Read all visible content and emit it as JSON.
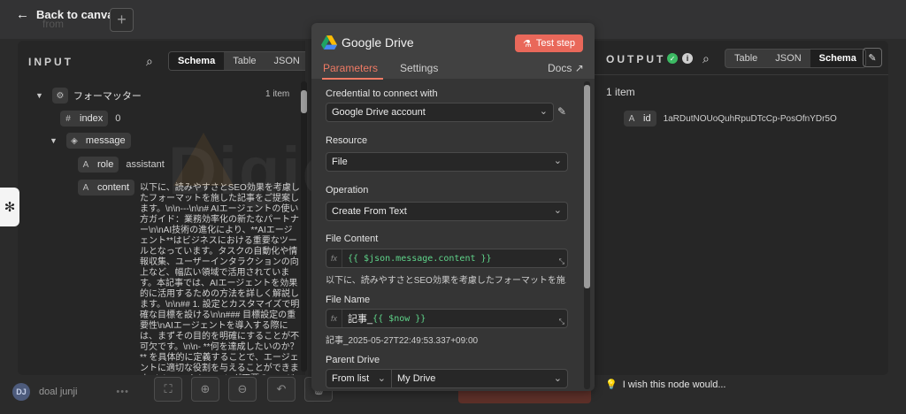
{
  "topbar": {
    "back_label": "Back to canvas",
    "back_icon": "arrow-left-icon",
    "ghost_label": "from",
    "plus_label": "+"
  },
  "input": {
    "title": "INPUT",
    "tabs": [
      "Schema",
      "Table",
      "JSON"
    ],
    "active_tab": "Schema",
    "node_name": "フォーマッター",
    "item_count": "1 item",
    "fields": [
      {
        "key": "index",
        "type_icon": "#",
        "value": "0"
      },
      {
        "key": "message",
        "type_icon": "cube"
      },
      {
        "key": "role",
        "type_icon": "A",
        "value": "assistant"
      },
      {
        "key": "content",
        "type_icon": "A"
      }
    ],
    "content_value": "以下に、読みやすさとSEO効果を考慮したフォーマットを施した記事をご提案します。\\n\\n---\\n\\n# AIエージェントの使い方ガイド：業務効率化の新たなパートナー\\n\\nAI技術の進化により、**AIエージェント**はビジネスにおける重要なツールとなっています。タスクの自動化や情報収集、ユーザーインタラクションの向上など、幅広い領域で活用されています。本記事では、AIエージェントを効果的に活用するための方法を詳しく解説します。\\n\\n## 1. 設定とカスタマイズで明確な目標を設ける\\n\\n### 目標設定の重要性\\nAIエージェントを導入する際には、まずその目的を明確にすることが不可欠です。\\n\\n- **何を達成したいのか？** を具体的に定義することで、エージェントに適切な役割を与えることができます。\\n\\n### トレーニング不要のエージェント\\n\\n最近のAIプラットフォームでは、専門的なプログラミング知識がなくても構築"
  },
  "node": {
    "title": "Google Drive",
    "test_label": "Test step",
    "tabs": {
      "parameters": "Parameters",
      "settings": "Settings",
      "docs": "Docs"
    },
    "credential": {
      "label": "Credential to connect with",
      "value": "Google Drive account"
    },
    "resource": {
      "label": "Resource",
      "value": "File"
    },
    "operation": {
      "label": "Operation",
      "value": "Create From Text"
    },
    "file_content": {
      "label": "File Content",
      "expression": "{{ $json.message.content }}",
      "preview": "以下に、読みやすさとSEO効果を考慮したフォーマットを施..."
    },
    "file_name": {
      "label": "File Name",
      "prefix": "記事_",
      "expression": "{{ $now }}",
      "preview": "記事_2025-05-27T22:49:53.337+09:00"
    },
    "parent_drive": {
      "label": "Parent Drive",
      "mode": "From list",
      "value": "My Drive"
    }
  },
  "output": {
    "title": "OUTPUT",
    "tabs": [
      "Table",
      "JSON",
      "Schema"
    ],
    "active_tab": "Schema",
    "item_count": "1 item",
    "field_key": "id",
    "field_value": "1aRDutNOUoQuhRpuDTcCp-PosOfnYDr5O"
  },
  "wish_label": "I wish this node would...",
  "user": {
    "initials": "DJ",
    "name": "doal junji"
  },
  "watermark": "Digicra",
  "colors": {
    "accent": "#ef7a64",
    "test_button": "#e9685a",
    "success": "#3cba63",
    "expression": "#5fd48a"
  }
}
